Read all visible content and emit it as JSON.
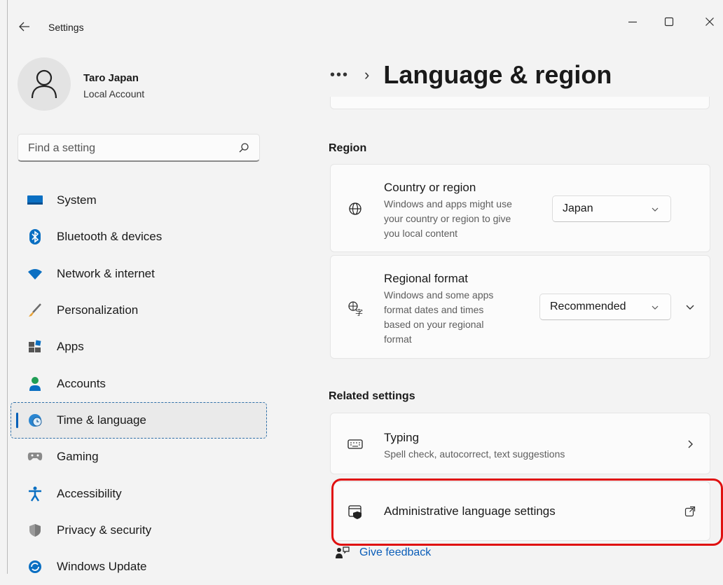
{
  "window": {
    "title": "Settings",
    "accent_color": "#005fb8",
    "highlight_color": "#e01010"
  },
  "profile": {
    "name": "Taro Japan",
    "account_type": "Local Account"
  },
  "search": {
    "placeholder": "Find a setting"
  },
  "sidebar": {
    "items": [
      {
        "label": "System",
        "icon": "system-icon"
      },
      {
        "label": "Bluetooth & devices",
        "icon": "bluetooth-icon"
      },
      {
        "label": "Network & internet",
        "icon": "wifi-icon"
      },
      {
        "label": "Personalization",
        "icon": "brush-icon"
      },
      {
        "label": "Apps",
        "icon": "apps-icon"
      },
      {
        "label": "Accounts",
        "icon": "person-icon"
      },
      {
        "label": "Time & language",
        "icon": "globe-clock-icon",
        "active": true
      },
      {
        "label": "Gaming",
        "icon": "gamepad-icon"
      },
      {
        "label": "Accessibility",
        "icon": "accessibility-icon"
      },
      {
        "label": "Privacy & security",
        "icon": "shield-icon"
      },
      {
        "label": "Windows Update",
        "icon": "update-icon"
      }
    ]
  },
  "main": {
    "breadcrumb_overflow": "•••",
    "breadcrumb_separator": "›",
    "page_title": "Language & region",
    "region": {
      "heading": "Region",
      "country": {
        "title": "Country or region",
        "description": [
          "Windows and apps might use",
          "your country or region to give",
          "you local content"
        ],
        "value": "Japan"
      },
      "format": {
        "title": "Regional format",
        "description": [
          "Windows and some apps",
          "format dates and times",
          "based on your regional",
          "format"
        ],
        "value": "Recommended"
      }
    },
    "related": {
      "heading": "Related settings",
      "typing": {
        "title": "Typing",
        "description": "Spell check, autocorrect, text suggestions"
      },
      "admin": {
        "title": "Administrative language settings"
      }
    },
    "feedback": "Give feedback"
  }
}
